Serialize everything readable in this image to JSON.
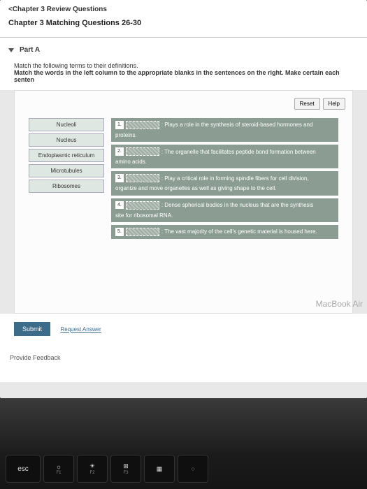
{
  "breadcrumb": "<Chapter 3 Review Questions",
  "page_title": "Chapter 3 Matching Questions 26-30",
  "part_a": {
    "label": "Part A",
    "instr1": "Match the following terms to their definitions.",
    "instr2": "Match the words in the left column to the appropriate blanks in the sentences on the right. Make certain each senten"
  },
  "buttons": {
    "reset": "Reset",
    "help": "Help",
    "submit": "Submit",
    "request": "Request Answer"
  },
  "terms": [
    "Nucleoli",
    "Nucleus",
    "Endoplasmic reticulum",
    "Microtubules",
    "Ribosomes"
  ],
  "defs": [
    {
      "num": "1.",
      "before": ": Plays a role in the synthesis of steroid-based hormones and",
      "cont": "proteins."
    },
    {
      "num": "2.",
      "before": ": The organelle that facilitates peptide bond formation between",
      "cont": "amino acids."
    },
    {
      "num": "3.",
      "before": ": Play a critical role in forming spindle fibers for cell division,",
      "cont": "organize and move organelles as well as giving shape to the cell."
    },
    {
      "num": "4.",
      "before": ": Dense spherical bodies in the nucleus that are the synthesis",
      "cont": "site for ribosomal RNA."
    },
    {
      "num": "5.",
      "before": ": The vast majority of the cell's genetic material is housed here.",
      "cont": ""
    }
  ],
  "feedback": "Provide Feedback",
  "macbook": "MacBook Air",
  "keys": {
    "esc": "esc",
    "f1": "F1",
    "f2": "F2",
    "f3": "F3"
  }
}
